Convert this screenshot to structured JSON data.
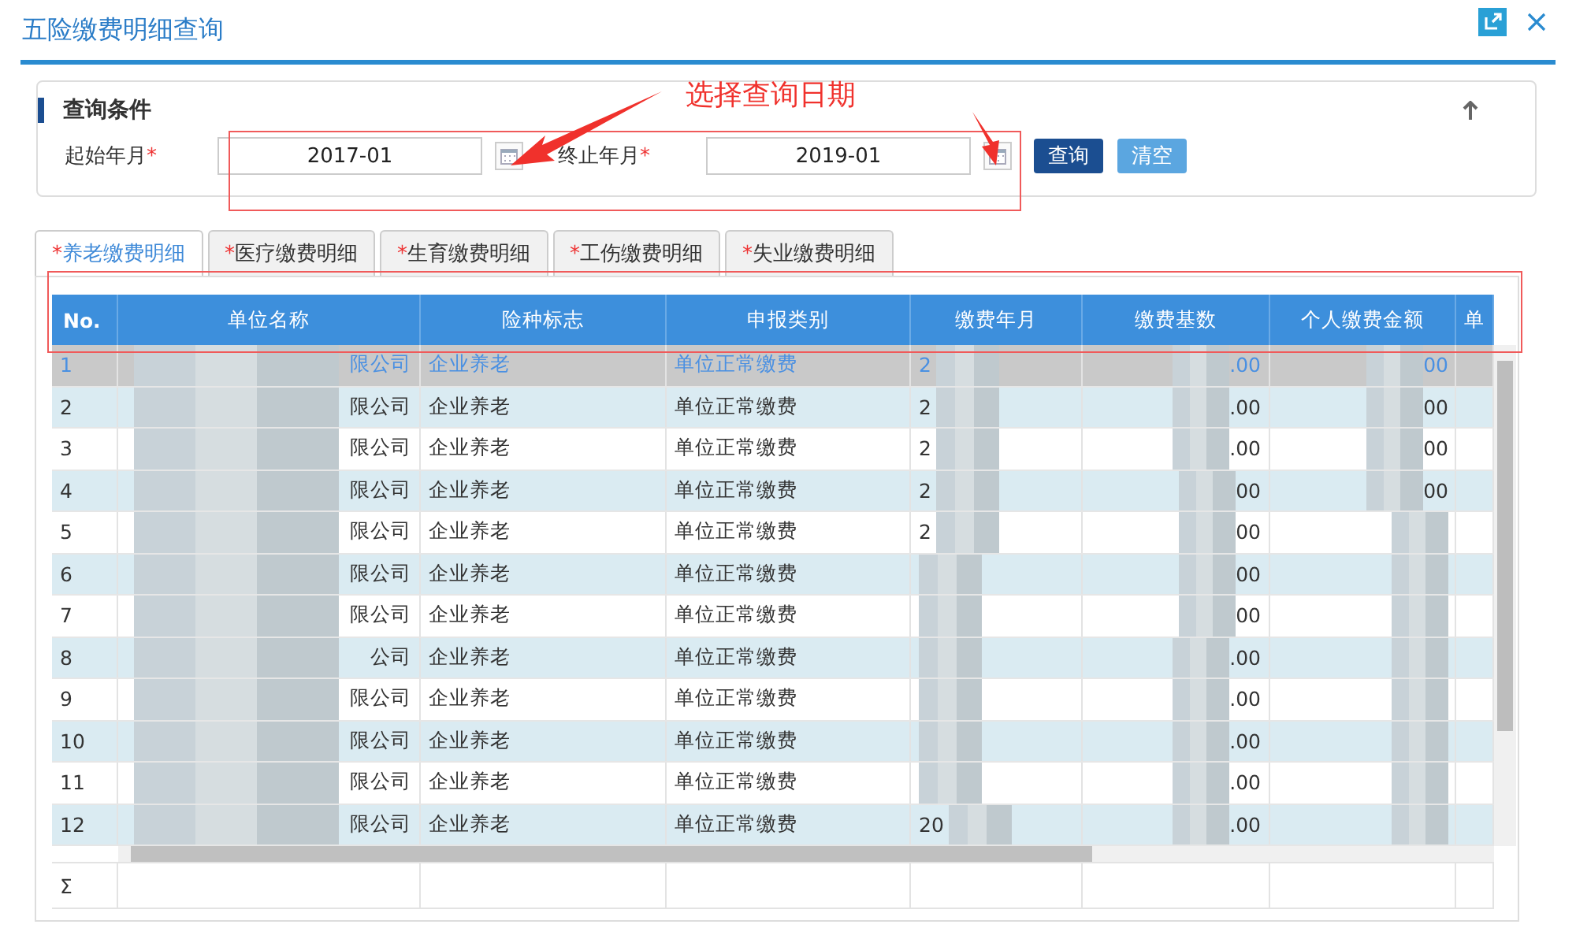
{
  "window": {
    "title": "五险缴费明细查询"
  },
  "query": {
    "title": "查询条件",
    "fields": [
      {
        "label": "起始年月",
        "required_mark": "*",
        "value": "2017-01"
      },
      {
        "label": "终止年月",
        "required_mark": "*",
        "value": "2019-01"
      }
    ],
    "buttons": [
      {
        "label": "查询",
        "kind": "primary"
      },
      {
        "label": "清空",
        "kind": "secondary"
      }
    ]
  },
  "annotation": {
    "text": "选择查询日期"
  },
  "tabs": [
    {
      "required_mark": "*",
      "label": "养老缴费明细",
      "selected": true
    },
    {
      "required_mark": "*",
      "label": "医疗缴费明细",
      "selected": false
    },
    {
      "required_mark": "*",
      "label": "生育缴费明细",
      "selected": false
    },
    {
      "required_mark": "*",
      "label": "工伤缴费明细",
      "selected": false
    },
    {
      "required_mark": "*",
      "label": "失业缴费明细",
      "selected": false
    }
  ],
  "table": {
    "columns": [
      "No.",
      "单位名称",
      "险种标志",
      "申报类别",
      "缴费年月",
      "缴费基数",
      "个人缴费金额",
      "单"
    ],
    "rows": [
      {
        "no": "1",
        "name": "限公司",
        "type": "企业养老",
        "category": "单位正常缴费",
        "year": "2",
        "base": ".00",
        "personal": "00",
        "selected": true
      },
      {
        "no": "2",
        "name": "限公司",
        "type": "企业养老",
        "category": "单位正常缴费",
        "year": "2",
        "base": ".00",
        "personal": "00",
        "selected": false
      },
      {
        "no": "3",
        "name": "限公司",
        "type": "企业养老",
        "category": "单位正常缴费",
        "year": "2",
        "base": ".00",
        "personal": "00",
        "selected": false
      },
      {
        "no": "4",
        "name": "限公司",
        "type": "企业养老",
        "category": "单位正常缴费",
        "year": "2",
        "base": "00",
        "personal": "00",
        "selected": false
      },
      {
        "no": "5",
        "name": "限公司",
        "type": "企业养老",
        "category": "单位正常缴费",
        "year": "2",
        "base": "00",
        "selected": false
      },
      {
        "no": "6",
        "name": "限公司",
        "type": "企业养老",
        "category": "单位正常缴费",
        "base": "00",
        "selected": false
      },
      {
        "no": "7",
        "name": "限公司",
        "type": "企业养老",
        "category": "单位正常缴费",
        "base": "00",
        "selected": false
      },
      {
        "no": "8",
        "name": "公司",
        "type": "企业养老",
        "category": "单位正常缴费",
        "base": ".00",
        "selected": false
      },
      {
        "no": "9",
        "name": "限公司",
        "type": "企业养老",
        "category": "单位正常缴费",
        "base": ".00",
        "selected": false
      },
      {
        "no": "10",
        "name": "限公司",
        "type": "企业养老",
        "category": "单位正常缴费",
        "base": ".00",
        "selected": false
      },
      {
        "no": "11",
        "name": "限公司",
        "type": "企业养老",
        "category": "单位正常缴费",
        "base": ".00",
        "selected": false
      },
      {
        "no": "12",
        "name": "限公司",
        "type": "企业养老",
        "category": "单位正常缴费",
        "year": "20",
        "base": ".00",
        "selected": false
      }
    ],
    "footer": {
      "label": "Σ"
    }
  }
}
